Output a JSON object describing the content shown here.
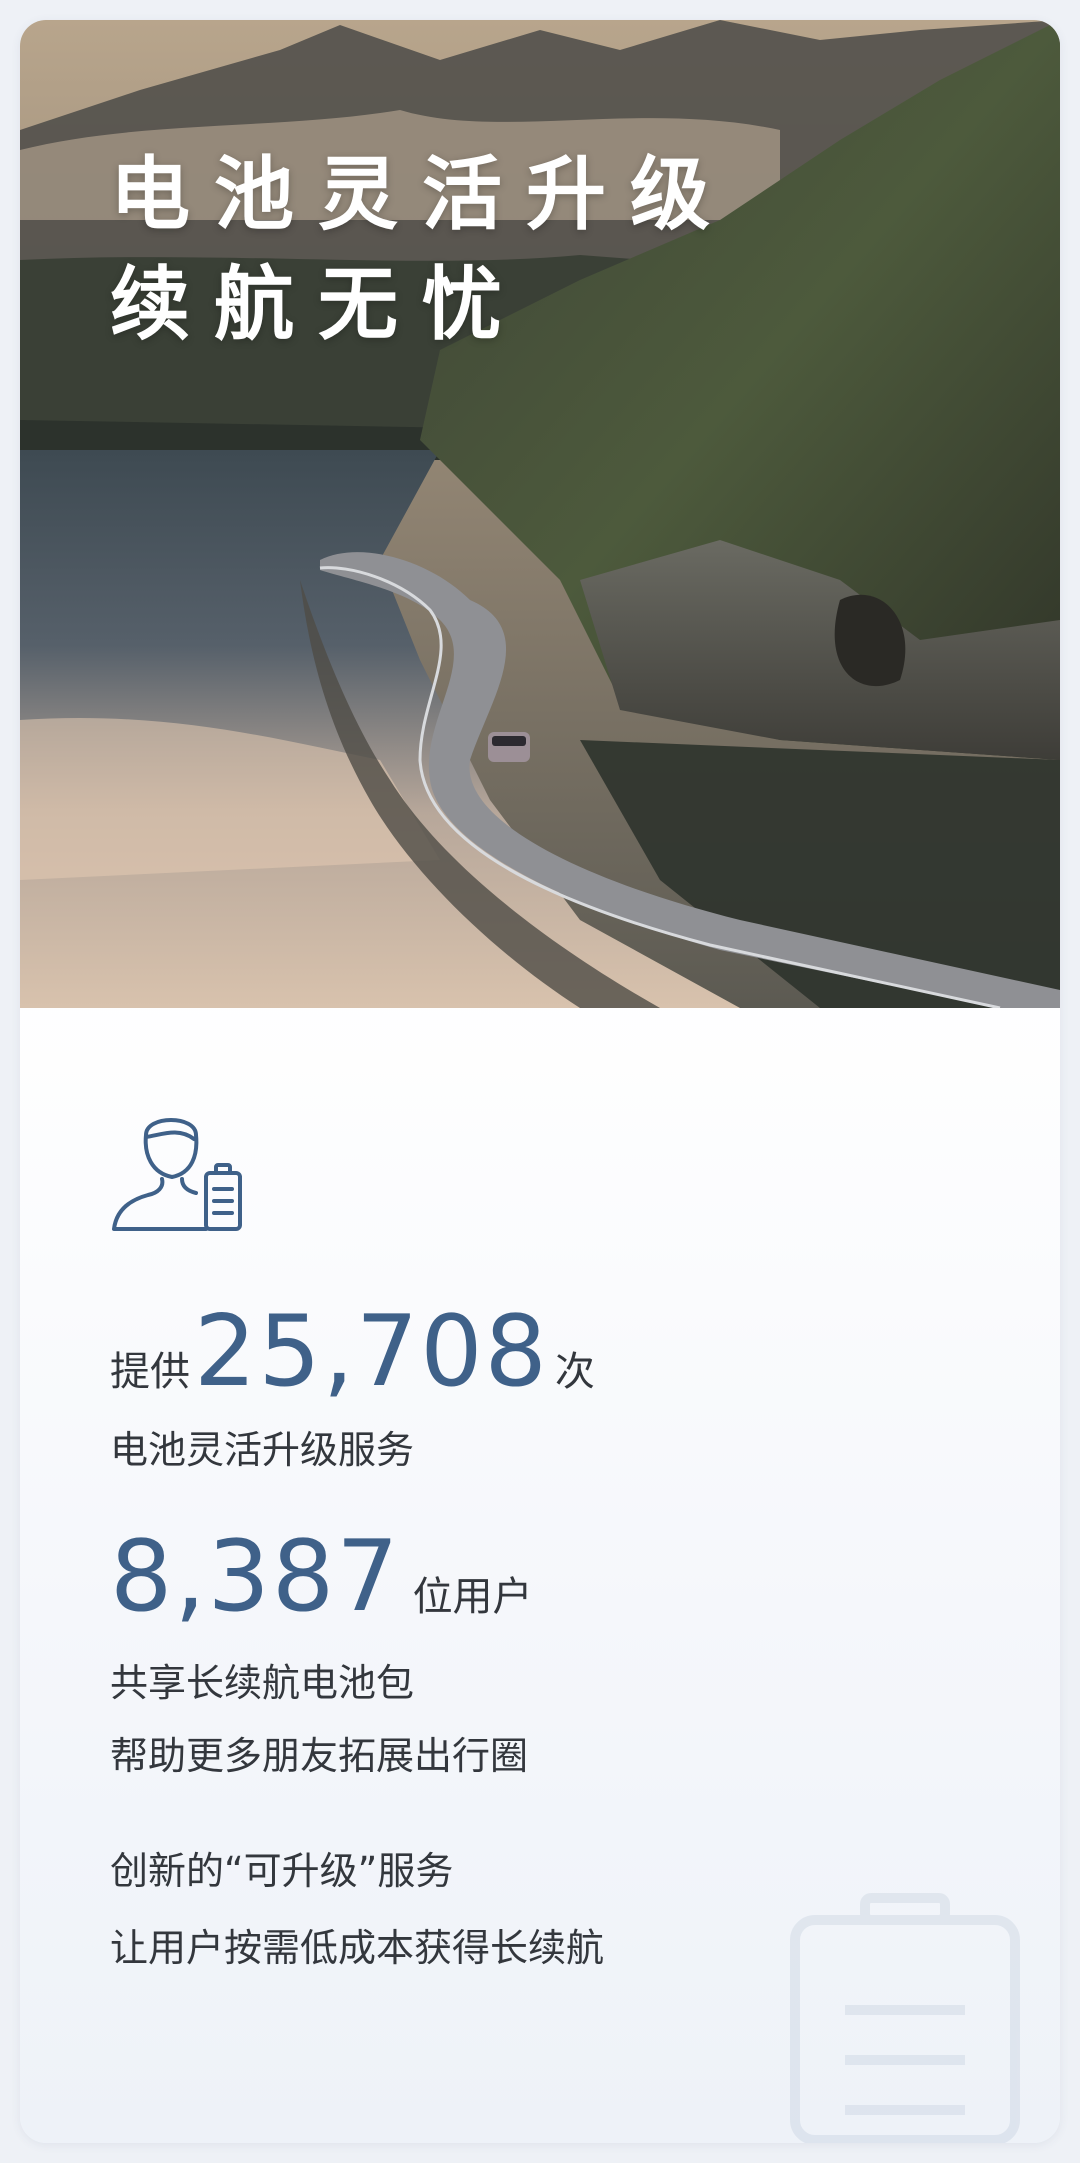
{
  "hero": {
    "title_line1": "电池灵活升级",
    "title_line2": "续航无忧",
    "image_description_icon": "mountain-lake-road-photo"
  },
  "stats": {
    "s1_prefix": "提供",
    "s1_number": "25,708",
    "s1_suffix": "次",
    "s1_desc": "电池灵活升级服务",
    "s2_number": "8,387",
    "s2_suffix": "位用户",
    "s2_desc1": "共享长续航电池包",
    "s2_desc2": "帮助更多朋友拓展出行圈",
    "s3_line1": "创新的“可升级”服务",
    "s3_line2": "让用户按需低成本获得长续航"
  },
  "icons": {
    "user_battery": "user-battery-icon",
    "watermark": "battery-watermark-icon"
  },
  "colors": {
    "accent": "#3f6189",
    "text": "#33373d",
    "background": "#eef1f6"
  }
}
